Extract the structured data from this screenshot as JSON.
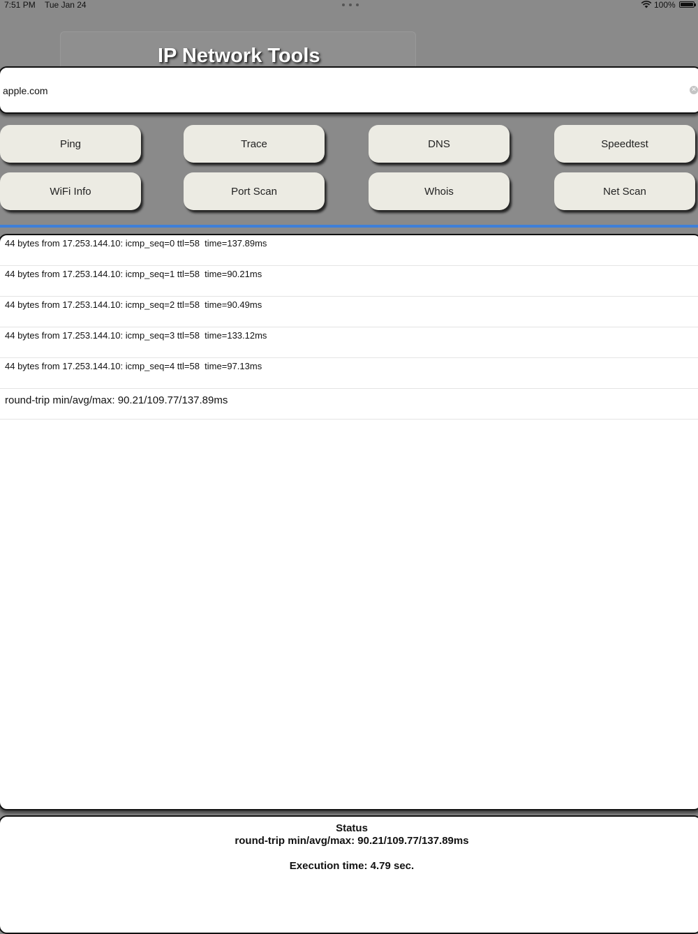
{
  "status_bar": {
    "time": "7:51 PM",
    "date": "Tue Jan 24",
    "battery": "100%",
    "wifi_icon": "wifi-icon",
    "battery_icon": "battery-icon"
  },
  "app": {
    "title": "IP Network Tools"
  },
  "host_input": {
    "value": "apple.com",
    "clear_icon": "clear-icon"
  },
  "tools": [
    {
      "label": "Ping"
    },
    {
      "label": "Trace"
    },
    {
      "label": "DNS"
    },
    {
      "label": "Speedtest"
    },
    {
      "label": "WiFi Info"
    },
    {
      "label": "Port Scan"
    },
    {
      "label": "Whois"
    },
    {
      "label": "Net Scan"
    }
  ],
  "results": {
    "rows": [
      "44 bytes from 17.253.144.10: icmp_seq=0 ttl=58  time=137.89ms",
      "44 bytes from 17.253.144.10: icmp_seq=1 ttl=58  time=90.21ms",
      "44 bytes from 17.253.144.10: icmp_seq=2 ttl=58  time=90.49ms",
      "44 bytes from 17.253.144.10: icmp_seq=3 ttl=58  time=133.12ms",
      "44 bytes from 17.253.144.10: icmp_seq=4 ttl=58  time=97.13ms"
    ],
    "summary": "round-trip min/avg/max: 90.21/109.77/137.89ms"
  },
  "status": {
    "heading": "Status",
    "summary": "round-trip min/avg/max: 90.21/109.77/137.89ms",
    "execution": "Execution time: 4.79 sec."
  },
  "colors": {
    "background": "#8a8a8a",
    "button": "#ecebe3",
    "divider": "#3f7fd8"
  }
}
